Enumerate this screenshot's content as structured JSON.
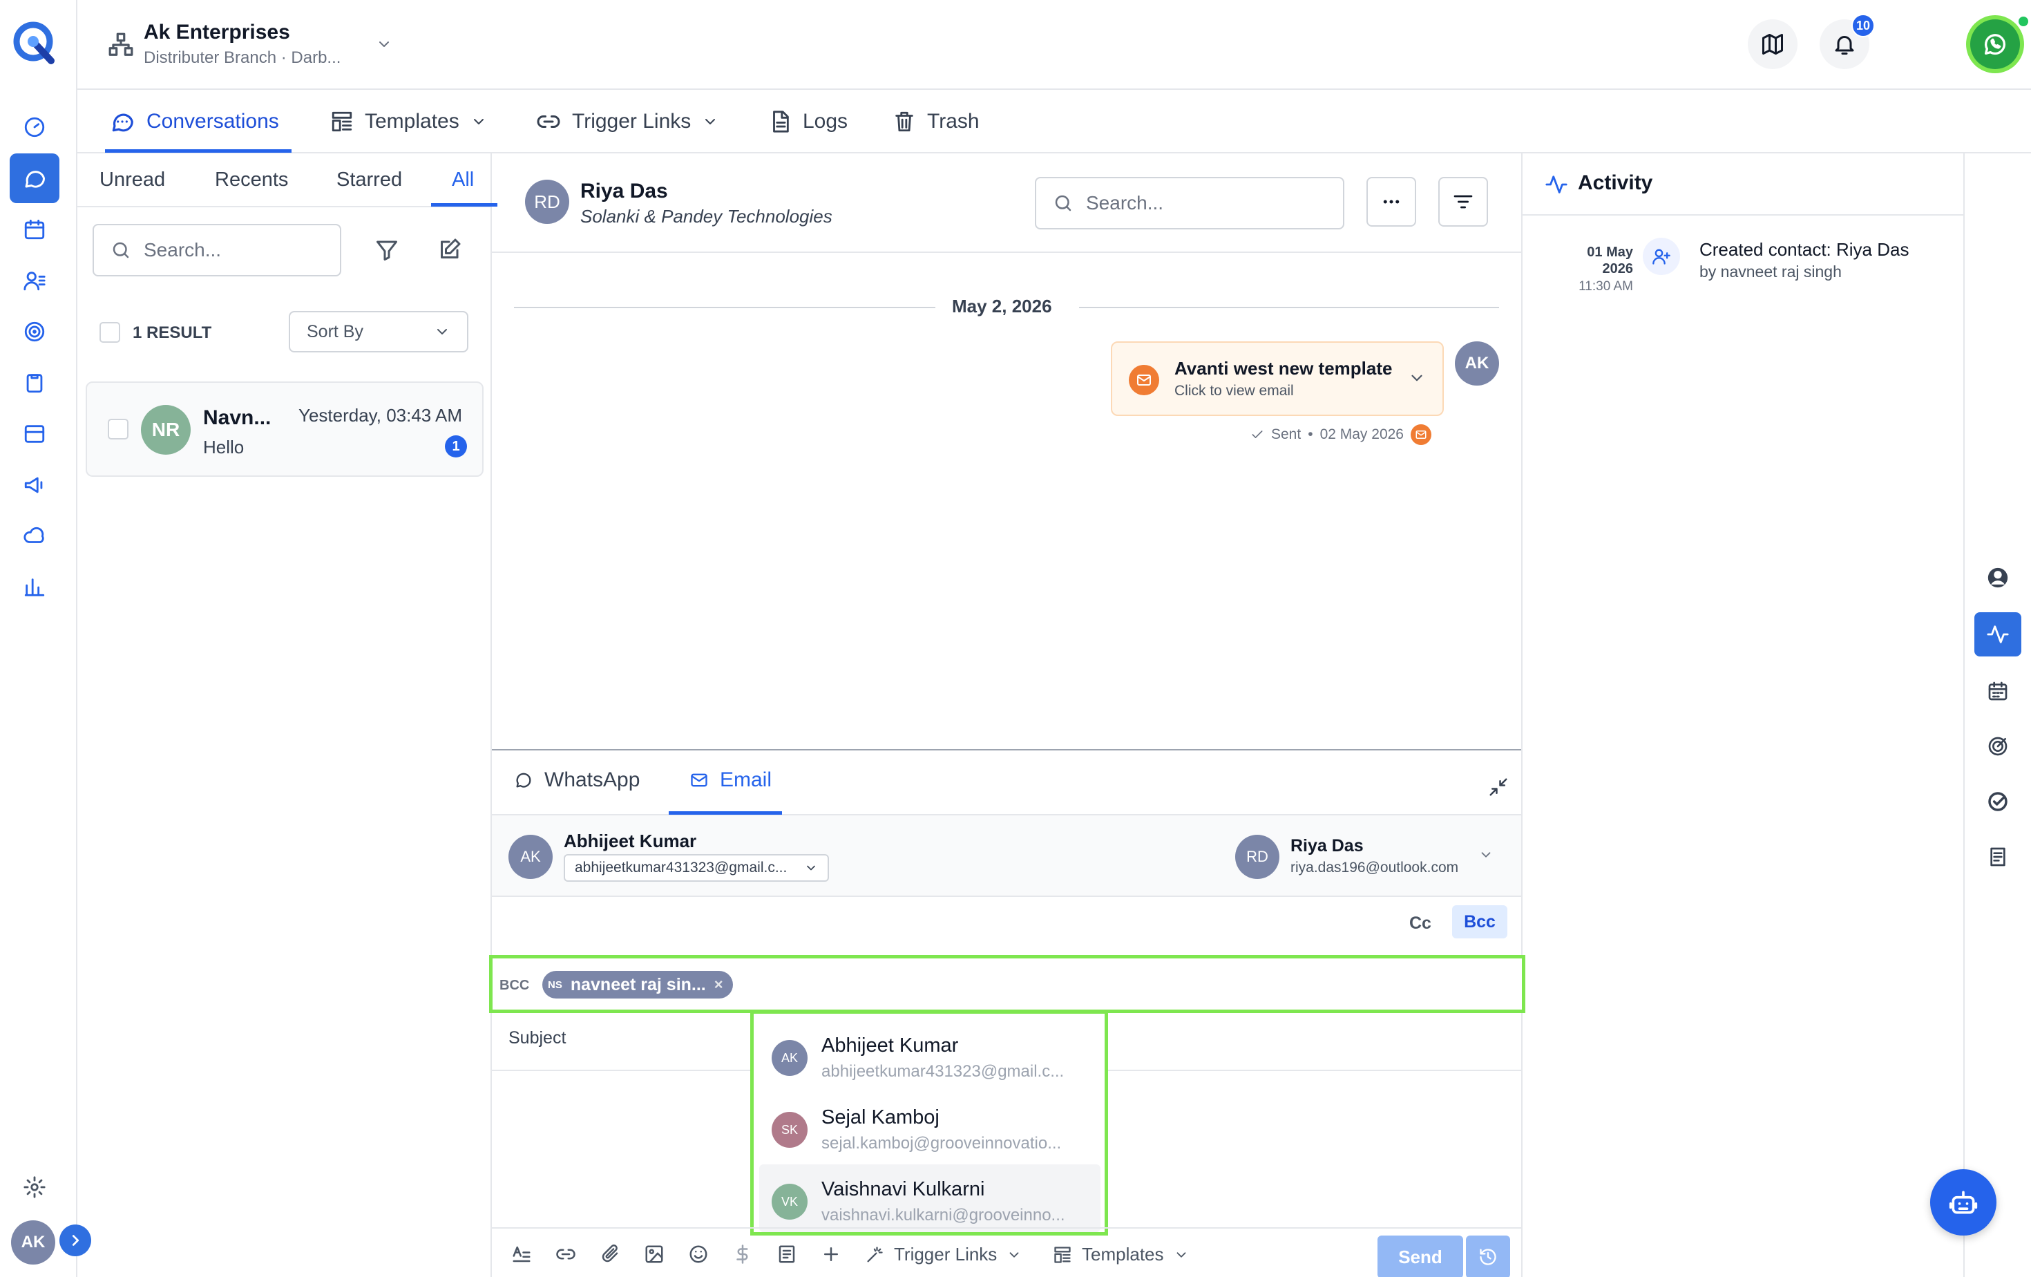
{
  "brand": {
    "logo": "logo-mark"
  },
  "header": {
    "org_name": "Ak Enterprises",
    "branch": "Distributer Branch · Darb...",
    "notifications_count": "10",
    "user_initials": "AK"
  },
  "nav_tabs": [
    {
      "label": "Conversations",
      "icon": "chat-icon"
    },
    {
      "label": "Templates",
      "icon": "template-icon"
    },
    {
      "label": "Trigger Links",
      "icon": "link-icon"
    },
    {
      "label": "Logs",
      "icon": "doc-icon"
    },
    {
      "label": "Trash",
      "icon": "trash-icon"
    }
  ],
  "list": {
    "filters": [
      "Unread",
      "Recents",
      "Starred",
      "All"
    ],
    "active_filter": "All",
    "search_placeholder": "Search...",
    "result_count": "1 RESULT",
    "sort_label": "Sort By",
    "items": [
      {
        "initials": "NR",
        "name": "Navn...",
        "time": "Yesterday, 03:43 AM",
        "preview": "Hello",
        "unread": "1"
      }
    ]
  },
  "conversation": {
    "contact_initials": "RD",
    "contact_name": "Riya Das",
    "company": "Solanki & Pandey Technologies",
    "search_placeholder": "Search...",
    "date_divider": "May 2, 2026",
    "message": {
      "title": "Avanti west new template",
      "subtitle": "Click to view email",
      "status": "Sent",
      "date": "02 May 2026",
      "sender_initials": "AK"
    }
  },
  "composer": {
    "tabs": [
      "WhatsApp",
      "Email"
    ],
    "active_tab": "Email",
    "from": {
      "initials": "AK",
      "name": "Abhijeet Kumar",
      "email": "abhijeetkumar431323@gmail.c..."
    },
    "to": {
      "initials": "RD",
      "name": "Riya Das",
      "email": "riya.das196@outlook.com"
    },
    "cc_label": "Cc",
    "bcc_label": "Bcc",
    "bcc_field_label": "BCC",
    "bcc_chip": {
      "initials": "NS",
      "name": "navneet raj sin..."
    },
    "subject_placeholder": "Subject",
    "suggestions": [
      {
        "initials": "AK",
        "name": "Abhijeet Kumar",
        "email": "abhijeetkumar431323@gmail.c...",
        "color": "#7b86a8"
      },
      {
        "initials": "SK",
        "name": "Sejal Kamboj",
        "email": "sejal.kamboj@grooveinnovatio...",
        "color": "#b07a8a"
      },
      {
        "initials": "VK",
        "name": "Vaishnavi Kulkarni",
        "email": "vaishnavi.kulkarni@grooveinno...",
        "color": "#86b398"
      }
    ],
    "toolbar": {
      "trigger_links": "Trigger Links",
      "templates": "Templates",
      "send": "Send"
    }
  },
  "activity": {
    "title": "Activity",
    "entries": [
      {
        "day": "01 May",
        "year": "2026",
        "time": "11:30 AM",
        "text": "Created contact: Riya Das",
        "by": "by navneet raj singh"
      }
    ]
  },
  "colors": {
    "primary": "#2563eb",
    "highlight": "#7ee64f",
    "whatsapp": "#25a244",
    "accent_orange": "#f07c33"
  }
}
